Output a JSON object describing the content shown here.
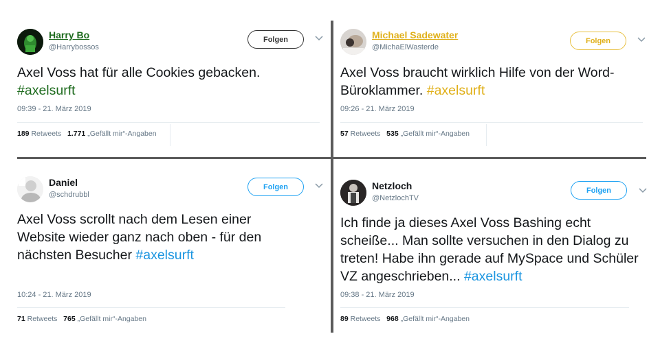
{
  "tweets": [
    {
      "name": "Harry Bo",
      "handle": "@Harrybossos",
      "name_color": "#1e6b1e",
      "follow_label": "Folgen",
      "text": "Axel Voss hat für alle Cookies gebacken.",
      "hashtag": "#axelsurft",
      "hashtag_color": "#1e6b1e",
      "time": "09:39 - 21. März 2019",
      "retweets_count": "189",
      "retweets_label": "Retweets",
      "likes_count": "1.771",
      "likes_label": "„Gefällt mir“-Angaben",
      "accent": "#333333"
    },
    {
      "name": "Michael Sadewater",
      "handle": "@MichaElWasterde",
      "name_color": "#e0b01a",
      "follow_label": "Folgen",
      "text": "Axel Voss braucht wirklich Hilfe von der Word-Büroklammer.",
      "hashtag": "#axelsurft",
      "hashtag_color": "#e0b01a",
      "time": "09:26 - 21. März 2019",
      "retweets_count": "57",
      "retweets_label": "Retweets",
      "likes_count": "535",
      "likes_label": "„Gefällt mir“-Angaben",
      "accent": "#e8c040"
    },
    {
      "name": "Daniel",
      "handle": "@schdrubbl",
      "name_color": "#14171a",
      "follow_label": "Folgen",
      "text": "Axel Voss scrollt nach dem Lesen einer Website wieder ganz nach oben - für den nächsten Besucher",
      "hashtag": "#axelsurft",
      "hashtag_color": "#1b95e0",
      "time": "10:24 - 21. März 2019",
      "retweets_count": "71",
      "retweets_label": "Retweets",
      "likes_count": "765",
      "likes_label": "„Gefällt mir“-Angaben",
      "accent": "#1da1f2"
    },
    {
      "name": "Netzloch",
      "handle": "@NetzlochTV",
      "name_color": "#14171a",
      "follow_label": "Folgen",
      "text": "Ich finde ja dieses Axel Voss Bashing echt scheiße... Man sollte versuchen in den Dialog zu treten! Habe ihn gerade auf MySpace und Schüler VZ angeschrieben...",
      "hashtag": "#axelsurft",
      "hashtag_color": "#1b95e0",
      "time": "09:38 - 21. März 2019",
      "retweets_count": "89",
      "retweets_label": "Retweets",
      "likes_count": "968",
      "likes_label": "„Gefällt mir“-Angaben",
      "accent": "#1da1f2"
    }
  ]
}
